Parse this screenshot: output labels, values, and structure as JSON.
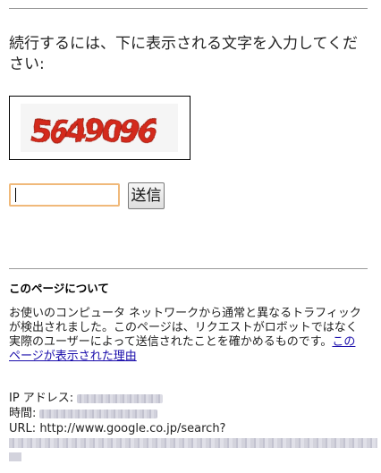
{
  "prompt": {
    "text": "続行するには、下に表示される文字を入力してください:"
  },
  "captcha": {
    "image_text": "5649096"
  },
  "form": {
    "input_value": "",
    "submit_label": "送信"
  },
  "about": {
    "heading": "このページについて",
    "body": "お使いのコンピュータ ネットワークから通常と異なるトラフィックが検出されました。このページは、リクエストがロボットではなく実際のユーザーによって送信されたことを確かめるものです。",
    "link_text": "このページが表示された理由"
  },
  "info": {
    "ip_label": "IP アドレス:",
    "time_label": "時間:",
    "url_label": "URL:",
    "url_value": "http://www.google.co.jp/search?"
  },
  "colors": {
    "captcha_red": "#d42a1a",
    "link": "#1a0dab",
    "input_border_focus": "#f0b97a"
  }
}
